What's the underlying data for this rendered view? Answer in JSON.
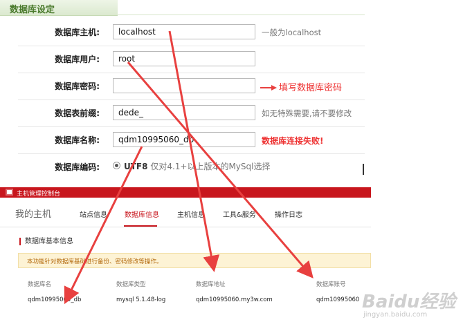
{
  "settings": {
    "title": "数据库设定",
    "rows": [
      {
        "label": "数据库主机:",
        "value": "localhost",
        "hint": "一般为localhost"
      },
      {
        "label": "数据库用户:",
        "value": "root",
        "hint": ""
      },
      {
        "label": "数据库密码:",
        "value": "",
        "hint": "填写数据库密码"
      },
      {
        "label": "数据表前缀:",
        "value": "dede_",
        "hint": "如无特殊需要,请不要修改"
      },
      {
        "label": "数据库名称:",
        "value": "qdm10995060_db",
        "hint": "数据库连接失败!"
      }
    ],
    "encoding": {
      "label": "数据库编码:",
      "option": "UTF8",
      "option_note": "仅对4.1+以上版本的MySql选择"
    }
  },
  "console": {
    "title": "主机管理控制台",
    "tabs": [
      "我的主机",
      "站点信息",
      "数据库信息",
      "主机信息",
      "工具&服务",
      "操作日志"
    ],
    "active_tab": "数据库信息",
    "section_title": "数据库基本信息",
    "notice": "本功能针对数据库基础进行备份、密码修改等操作。",
    "table": {
      "headers": [
        "数据库名",
        "数据库类型",
        "数据库地址",
        "数据库账号"
      ],
      "row": [
        "qdm10995060_db",
        "mysql 5.1.48-log",
        "qdm10995060.my3w.com",
        "qdm10995060"
      ]
    }
  },
  "watermark": {
    "main": "Baidu经验",
    "sub": "jingyan.baidu.com"
  },
  "colors": {
    "annotation_red": "#e8403f",
    "console_red": "#c8161d",
    "header_green": "#4a7a2c"
  }
}
